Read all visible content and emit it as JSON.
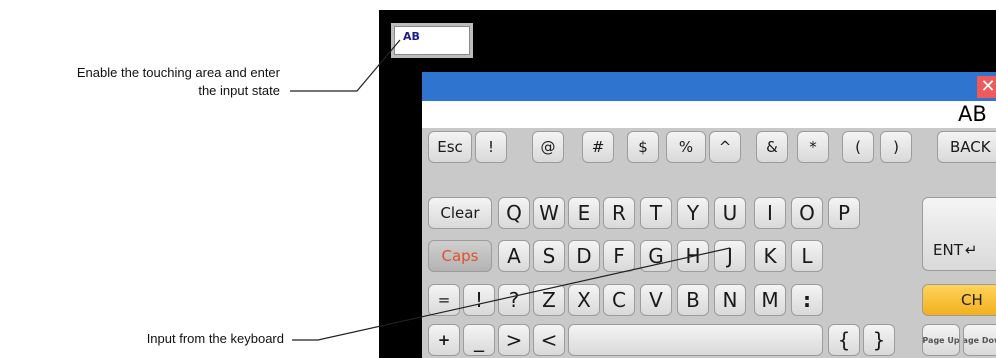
{
  "callouts": {
    "touch_line1": "Enable the touching area and enter",
    "touch_line2": "the input state",
    "keyboard_input": "Input from the keyboard"
  },
  "screen": {
    "input_field_value": "AB"
  },
  "keyboard": {
    "close_symbol": "✕",
    "display_value": "AB",
    "rows": [
      [
        "Esc",
        "!",
        "@",
        "#",
        "$",
        "%",
        "^",
        "&",
        "*",
        "(",
        ")",
        "BACK"
      ],
      [
        "Clear",
        "Q",
        "W",
        "E",
        "R",
        "T",
        "Y",
        "U",
        "I",
        "O",
        "P"
      ],
      [
        "Caps",
        "A",
        "S",
        "D",
        "F",
        "G",
        "H",
        "J",
        "K",
        "L",
        "ENT"
      ],
      [
        "=",
        "!",
        "?",
        "Z",
        "X",
        "C",
        "V",
        "B",
        "N",
        "M",
        ":",
        "CH"
      ],
      [
        "+",
        "_",
        ">",
        "<",
        "",
        "{",
        "}",
        "Page Up",
        "Page Down"
      ]
    ],
    "enter_icon": "return-arrow-icon",
    "colors": {
      "titlebar": "#2f74cf",
      "caps_text": "#e2502a",
      "ch_key": "#f2b01e",
      "close_button": "#f05a5a"
    }
  }
}
